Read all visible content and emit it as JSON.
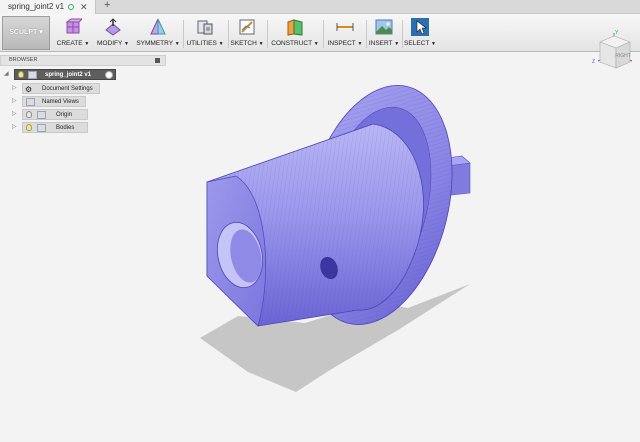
{
  "tab": {
    "title": "spring_joint2 v1",
    "add": "+"
  },
  "toolbar": {
    "workspace": "SCULPT",
    "tools": [
      {
        "label": "CREATE",
        "icon": "create-cube-icon"
      },
      {
        "label": "MODIFY",
        "icon": "modify-icon"
      },
      {
        "label": "SYMMETRY",
        "icon": "symmetry-icon"
      },
      {
        "label": "UTILITIES",
        "icon": "utilities-icon"
      },
      {
        "label": "SKETCH",
        "icon": "sketch-icon"
      },
      {
        "label": "CONSTRUCT",
        "icon": "construct-icon"
      },
      {
        "label": "INSPECT",
        "icon": "inspect-icon"
      },
      {
        "label": "INSERT",
        "icon": "insert-icon"
      },
      {
        "label": "SELECT",
        "icon": "select-arrow-icon"
      }
    ]
  },
  "browser": {
    "title": "BROWSER",
    "root": "spring_joint2 v1",
    "items": [
      {
        "label": "Document Settings",
        "icon": "gear-icon"
      },
      {
        "label": "Named Views",
        "icon": "folder-icon"
      },
      {
        "label": "Origin",
        "icon": "folder-icon"
      },
      {
        "label": "Bodies",
        "icon": "folder-icon"
      }
    ]
  },
  "viewcube": {
    "face": "RIGHT",
    "axis_y": "Y",
    "axis_z": "Z"
  },
  "colors": {
    "body": "#8e8ae6",
    "body_dark": "#5a54c9",
    "body_light": "#b7b4f3",
    "shadow": "#c4c4c4"
  }
}
